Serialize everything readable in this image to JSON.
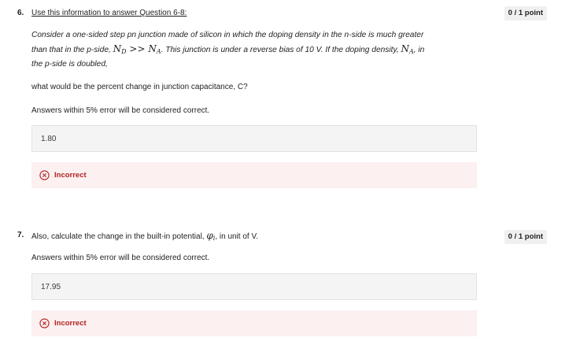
{
  "questions": [
    {
      "number": "6.",
      "title": "Use this information to answer Question 6-8:",
      "points": "0 / 1 point",
      "intro_line1": "Consider a one-sided step pn junction made of silicon in which the doping density in the n-side is much greater",
      "intro_line2_a": "than that in the p-side, ",
      "math_nd": "N",
      "math_nd_sub": "D",
      "math_gg": " >> ",
      "math_na": "N",
      "math_na_sub": "A",
      "intro_line2_b": ". This junction is under a reverse bias of 10 V. If the doping density, ",
      "math_na2": "N",
      "math_na2_sub": "A",
      "intro_line2_c": ", in",
      "intro_line3": "the p-side is doubled,",
      "prompt": "what would be the percent change in junction capacitance, C?",
      "tolerance_note": "Answers within 5% error will be considered correct.",
      "answer": "1.80",
      "feedback": "Incorrect",
      "feedback_icon": "x-circle-icon"
    },
    {
      "number": "7.",
      "prompt_a": "Also, calculate the change in the built-in potential, ",
      "math_phi": "φ",
      "math_phi_sub": "i",
      "prompt_b": ", in unit of V.",
      "points": "0 / 1 point",
      "tolerance_note": "Answers within 5% error will be considered correct.",
      "answer": "17.95",
      "feedback": "Incorrect",
      "feedback_icon": "x-circle-icon"
    }
  ],
  "colors": {
    "incorrect": "#b32222",
    "feedback_bg": "#fcf0f0",
    "answer_bg": "#f4f4f4",
    "points_bg": "#f0f0f0"
  }
}
